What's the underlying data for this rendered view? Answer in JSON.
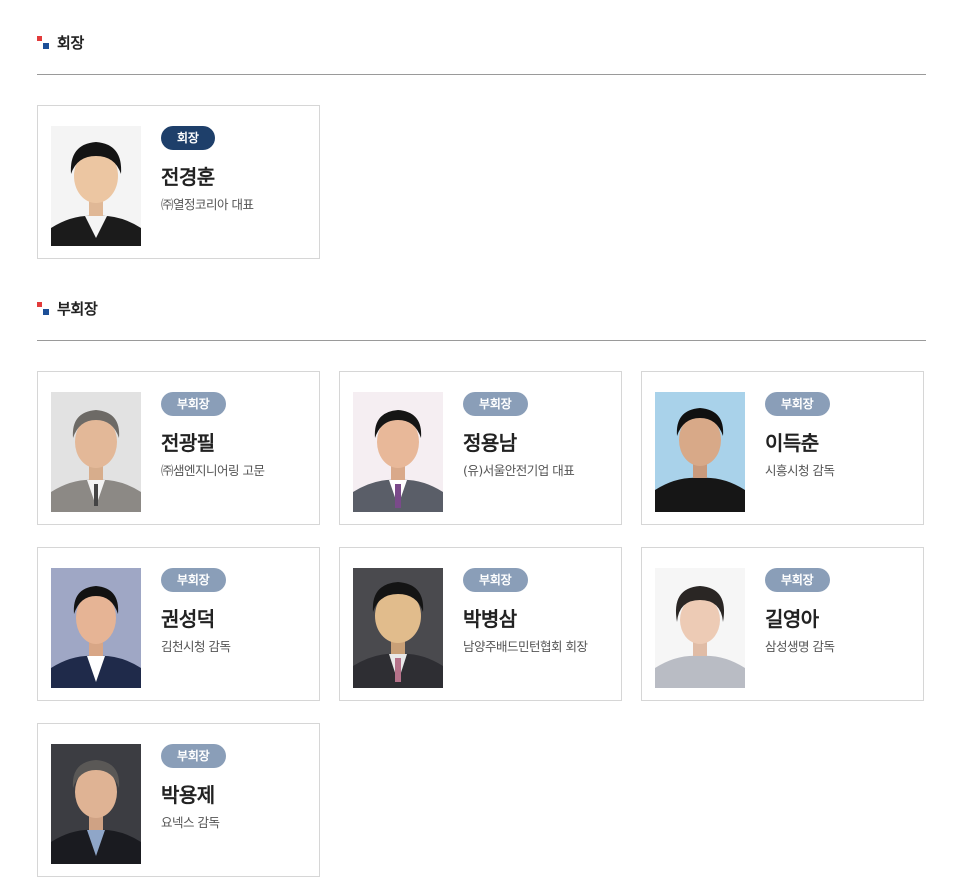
{
  "chairman_section": {
    "title": "회장",
    "members": [
      {
        "role": "회장",
        "name": "전경훈",
        "org": "㈜열정코리아 대표"
      }
    ]
  },
  "vice_section": {
    "title": "부회장",
    "members": [
      {
        "role": "부회장",
        "name": "전광필",
        "org": "㈜샘엔지니어링 고문"
      },
      {
        "role": "부회장",
        "name": "정용남",
        "org": "(유)서울안전기업 대표"
      },
      {
        "role": "부회장",
        "name": "이득춘",
        "org": "시흥시청 감독"
      },
      {
        "role": "부회장",
        "name": "권성덕",
        "org": "김천시청 감독"
      },
      {
        "role": "부회장",
        "name": "박병삼",
        "org": "남양주배드민턴협회 회장"
      },
      {
        "role": "부회장",
        "name": "길영아",
        "org": "삼성생명 감독"
      },
      {
        "role": "부회장",
        "name": "박용제",
        "org": "요넥스 감독"
      }
    ]
  },
  "colors": {
    "chairman_badge": "#1e3f6a",
    "vice_badge": "#8a9eb8",
    "mark_red": "#e23b3b",
    "mark_blue": "#1c4f97"
  },
  "icons": {
    "section_marker": "section-marker-icon"
  }
}
